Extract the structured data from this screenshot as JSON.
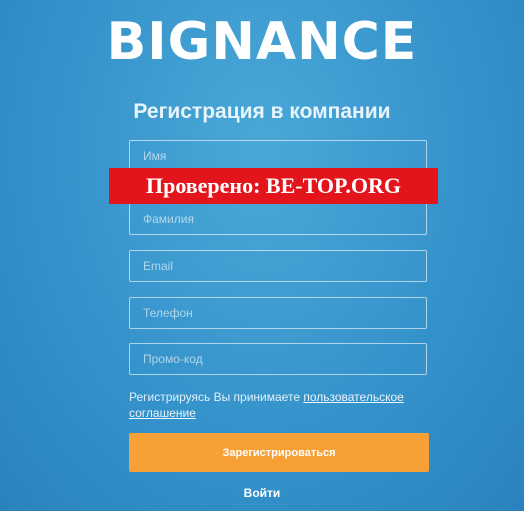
{
  "brand": {
    "logo": "BIGNANCE"
  },
  "form": {
    "title": "Регистрация в компании",
    "fields": [
      {
        "placeholder": "Имя"
      },
      {
        "placeholder": "Фамилия"
      },
      {
        "placeholder": "Email"
      },
      {
        "placeholder": "Телефон"
      },
      {
        "placeholder": "Промо-код"
      }
    ],
    "agreement_text": "Регистрируясь Вы принимаете ",
    "agreement_link": "пользовательское соглашение",
    "submit_label": "Зарегистрироваться",
    "login_link": "Войти"
  },
  "watermark": {
    "text": "Проверено: BE-TOP.ORG"
  },
  "colors": {
    "background": "#3593cb",
    "accent": "#f7a035",
    "banner": "#e4141d"
  }
}
